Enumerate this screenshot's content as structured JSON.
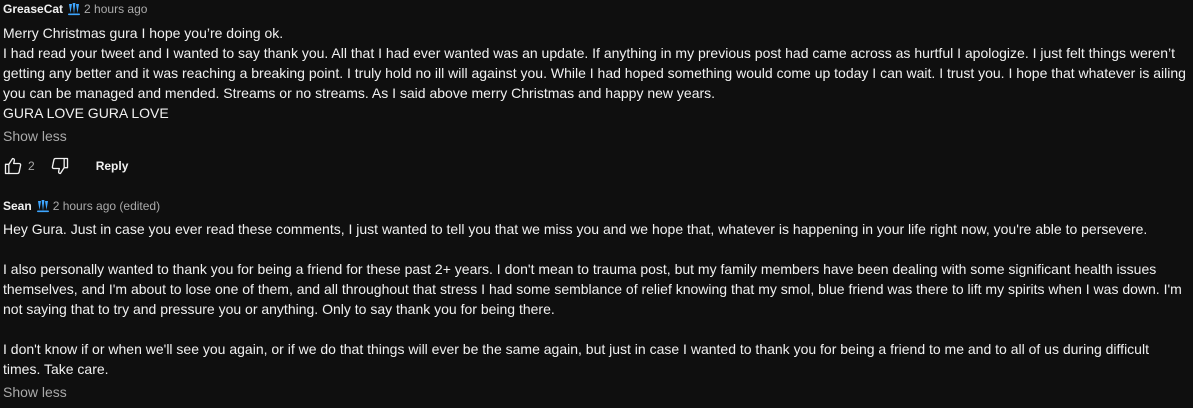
{
  "comments": [
    {
      "author": "GreaseCat",
      "badge_icon": "membership-badge-icon",
      "time": "2 hours ago",
      "lines": [
        "Merry Christmas gura I hope you’re doing ok.",
        "I had read your tweet and I wanted to say thank you. All that I had ever wanted was an update. If anything in my previous post had came across as hurtful I apologize. I just felt things weren’t getting any better and it was reaching a breaking point. I truly hold no ill will against you. While I had hoped something would come up today I can wait. I trust you. I hope that whatever is ailing you can be managed and mended. Streams or no streams. As I said above merry Christmas and happy new years.",
        "GURA LOVE GURA LOVE"
      ],
      "show_less": "Show less",
      "like_count": "2",
      "reply_label": "Reply"
    },
    {
      "author": "Sean",
      "badge_icon": "membership-badge-icon",
      "time": "2 hours ago (edited)",
      "paragraphs": [
        "Hey Gura. Just in case you ever read these comments, I just wanted to tell you that we miss you and we hope that, whatever is happening in your life right now, you're able to persevere.",
        "I also personally wanted to thank you for being a friend for these past 2+ years. I don't mean to trauma post, but my family members have been dealing with some significant health issues themselves, and I'm about to lose one of them, and all throughout that stress I had some semblance of relief knowing that my smol, blue friend was there to lift my spirits when I was down. I'm not saying that to try and pressure you or anything. Only to say thank you for being there.",
        "I don't know if or when we'll see you again, or if we do that things will ever be the same again, but just in case I wanted to thank you for being a friend to me and to all of us during difficult times. Take care."
      ],
      "show_less": "Show less"
    }
  ],
  "colors": {
    "background": "#0f0f0f",
    "text": "#f1f1f1",
    "secondary_text": "#aaaaaa",
    "badge": "#3ea6ff"
  }
}
